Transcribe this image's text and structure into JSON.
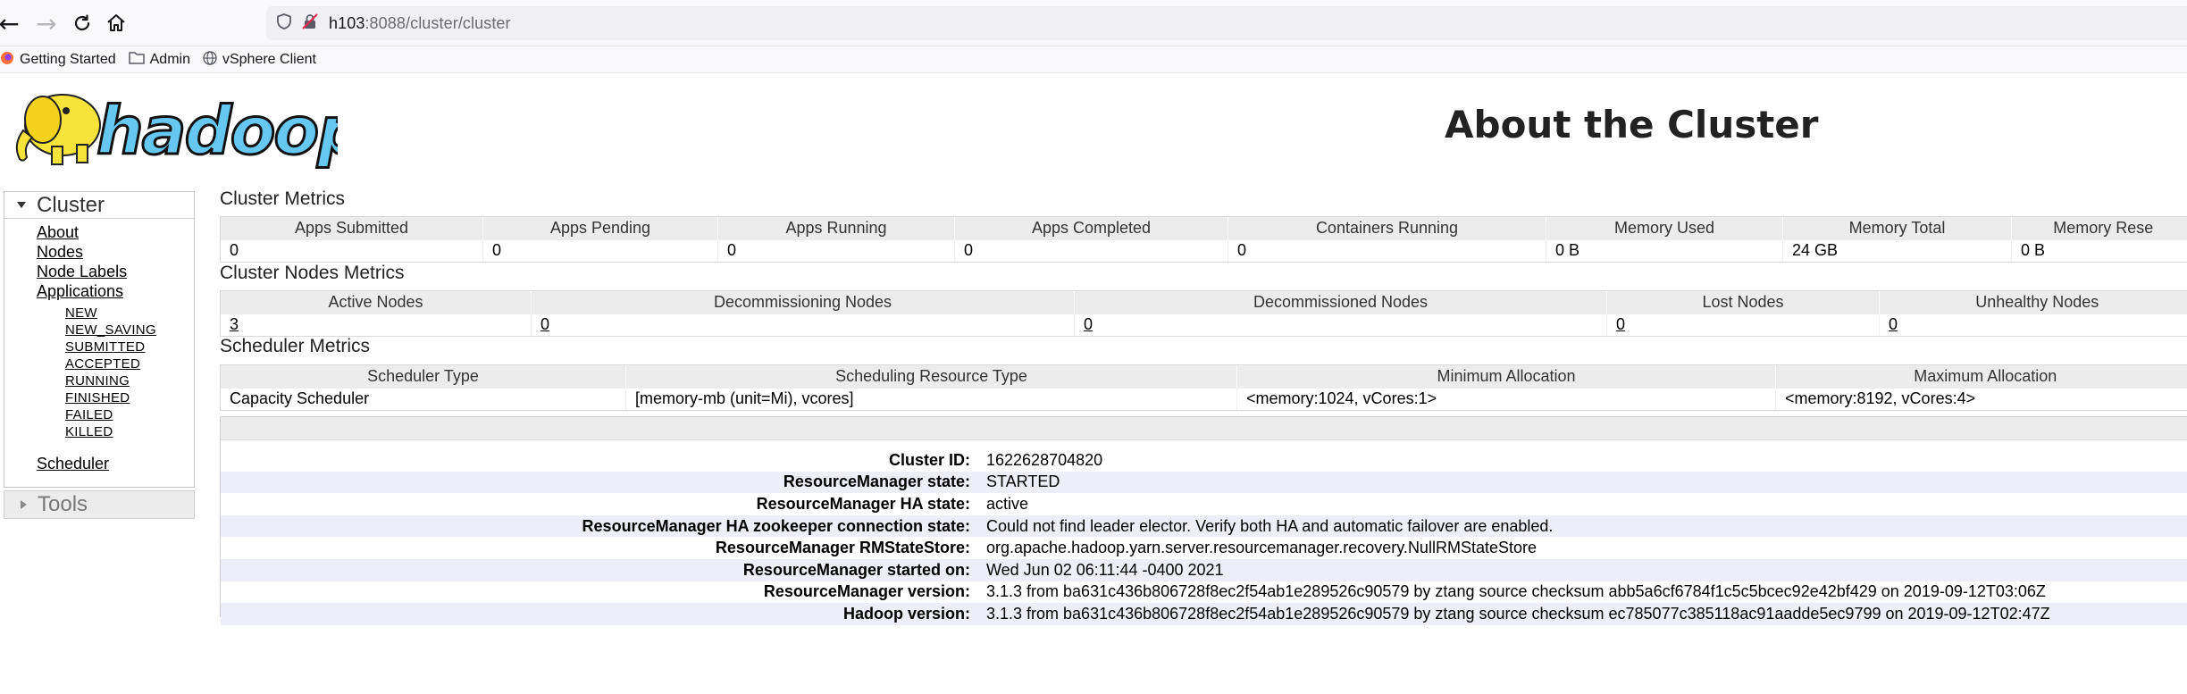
{
  "browser": {
    "url_host": "h103",
    "url_rest": ":8088/cluster/cluster",
    "bookmarks": [
      {
        "label": "Getting Started",
        "icon": "firefox-icon"
      },
      {
        "label": "Admin",
        "icon": "folder-icon"
      },
      {
        "label": "vSphere Client",
        "icon": "globe-icon"
      }
    ]
  },
  "header": {
    "logo_text": "hadoop",
    "title": "About the Cluster"
  },
  "sidebar": {
    "cluster_label": "Cluster",
    "links": [
      "About",
      "Nodes",
      "Node Labels",
      "Applications"
    ],
    "app_states": [
      "NEW",
      "NEW_SAVING",
      "SUBMITTED",
      "ACCEPTED",
      "RUNNING",
      "FINISHED",
      "FAILED",
      "KILLED"
    ],
    "scheduler_label": "Scheduler",
    "tools_label": "Tools"
  },
  "cluster_metrics": {
    "title": "Cluster Metrics",
    "headers": [
      "Apps Submitted",
      "Apps Pending",
      "Apps Running",
      "Apps Completed",
      "Containers Running",
      "Memory Used",
      "Memory Total",
      "Memory Rese"
    ],
    "values": [
      "0",
      "0",
      "0",
      "0",
      "0",
      "0 B",
      "24 GB",
      "0 B"
    ]
  },
  "node_metrics": {
    "title": "Cluster Nodes Metrics",
    "headers": [
      "Active Nodes",
      "Decommissioning Nodes",
      "Decommissioned Nodes",
      "Lost Nodes",
      "Unhealthy Nodes"
    ],
    "values": [
      "3",
      "0",
      "0",
      "0",
      "0"
    ]
  },
  "scheduler_metrics": {
    "title": "Scheduler Metrics",
    "headers": [
      "Scheduler Type",
      "Scheduling Resource Type",
      "Minimum Allocation",
      "Maximum Allocation"
    ],
    "values": [
      "Capacity Scheduler",
      "[memory-mb (unit=Mi), vcores]",
      "<memory:1024, vCores:1>",
      "<memory:8192, vCores:4>"
    ]
  },
  "cluster_info": [
    {
      "label": "Cluster ID:",
      "value": "1622628704820"
    },
    {
      "label": "ResourceManager state:",
      "value": "STARTED"
    },
    {
      "label": "ResourceManager HA state:",
      "value": "active"
    },
    {
      "label": "ResourceManager HA zookeeper connection state:",
      "value": "Could not find leader elector. Verify both HA and automatic failover are enabled."
    },
    {
      "label": "ResourceManager RMStateStore:",
      "value": "org.apache.hadoop.yarn.server.resourcemanager.recovery.NullRMStateStore"
    },
    {
      "label": "ResourceManager started on:",
      "value": "Wed Jun 02 06:11:44 -0400 2021"
    },
    {
      "label": "ResourceManager version:",
      "value": "3.1.3 from ba631c436b806728f8ec2f54ab1e289526c90579 by ztang source checksum abb5a6cf6784f1c5c5bcec92e42bf429 on 2019-09-12T03:06Z"
    },
    {
      "label": "Hadoop version:",
      "value": "3.1.3 from ba631c436b806728f8ec2f54ab1e289526c90579 by ztang source checksum ec785077c385118ac91aadde5ec9799 on 2019-09-12T02:47Z"
    }
  ]
}
